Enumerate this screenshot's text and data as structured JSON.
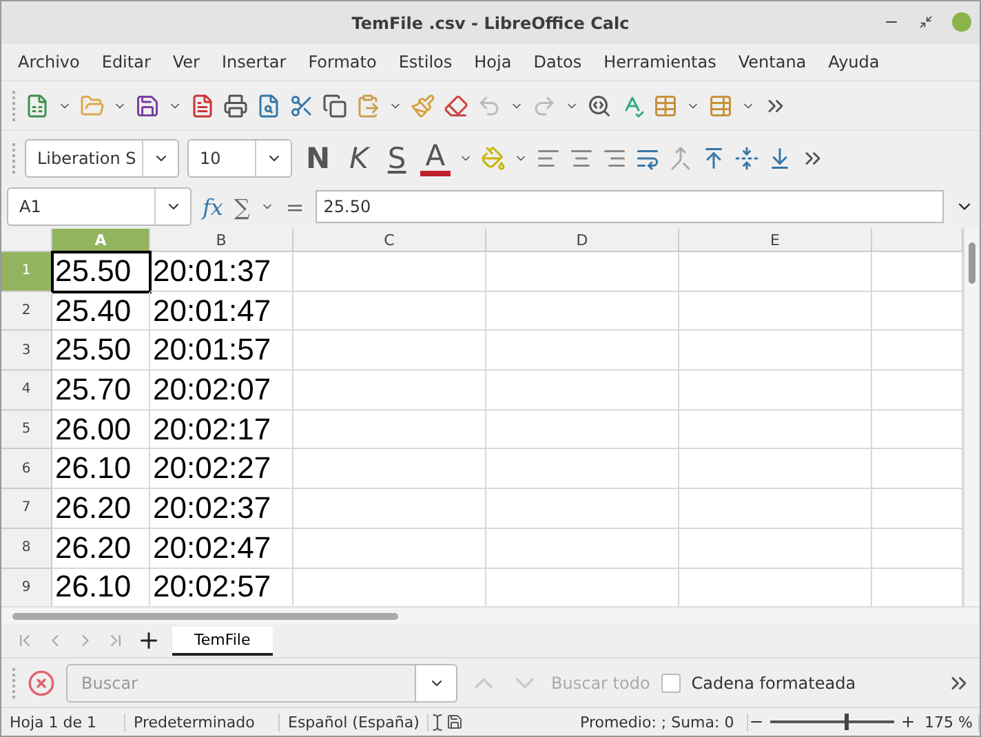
{
  "window": {
    "title": "TemFile .csv - LibreOffice Calc"
  },
  "menu": [
    "Archivo",
    "Editar",
    "Ver",
    "Insertar",
    "Formato",
    "Estilos",
    "Hoja",
    "Datos",
    "Herramientas",
    "Ventana",
    "Ayuda"
  ],
  "format_toolbar": {
    "font_name": "Liberation S",
    "font_size": "10",
    "bold": "N",
    "italic": "K",
    "underline": "S",
    "font_color": "A"
  },
  "formula_bar": {
    "name_box": "A1",
    "function_symbol": "fx",
    "sum_symbol": "∑",
    "equals_symbol": "=",
    "content": "25.50"
  },
  "columns": [
    {
      "label": "A",
      "selected": true
    },
    {
      "label": "B",
      "selected": false
    },
    {
      "label": "C",
      "selected": false
    },
    {
      "label": "D",
      "selected": false
    },
    {
      "label": "E",
      "selected": false
    }
  ],
  "rows": [
    {
      "number": "1",
      "selected": true,
      "cells": [
        "25.50",
        "20:01:37"
      ]
    },
    {
      "number": "2",
      "selected": false,
      "cells": [
        "25.40",
        "20:01:47"
      ]
    },
    {
      "number": "3",
      "selected": false,
      "cells": [
        "25.50",
        "20:01:57"
      ]
    },
    {
      "number": "4",
      "selected": false,
      "cells": [
        "25.70",
        "20:02:07"
      ]
    },
    {
      "number": "5",
      "selected": false,
      "cells": [
        "26.00",
        "20:02:17"
      ]
    },
    {
      "number": "6",
      "selected": false,
      "cells": [
        "26.10",
        "20:02:27"
      ]
    },
    {
      "number": "7",
      "selected": false,
      "cells": [
        "26.20",
        "20:02:37"
      ]
    },
    {
      "number": "8",
      "selected": false,
      "cells": [
        "26.20",
        "20:02:47"
      ]
    },
    {
      "number": "9",
      "selected": false,
      "cells": [
        "26.10",
        "20:02:57"
      ]
    }
  ],
  "sheet_tabs": [
    {
      "label": "TemFile",
      "selected": true
    }
  ],
  "find_bar": {
    "placeholder": "Buscar",
    "find_all": "Buscar todo",
    "formatted_label": "Cadena formateada",
    "formatted_checked": false
  },
  "status_bar": {
    "sheet": "Hoja 1 de 1",
    "style": "Predeterminado",
    "language": "Español (España)",
    "summary": "Promedio: ; Suma: 0",
    "zoom": "175 %",
    "level": 0.6
  }
}
